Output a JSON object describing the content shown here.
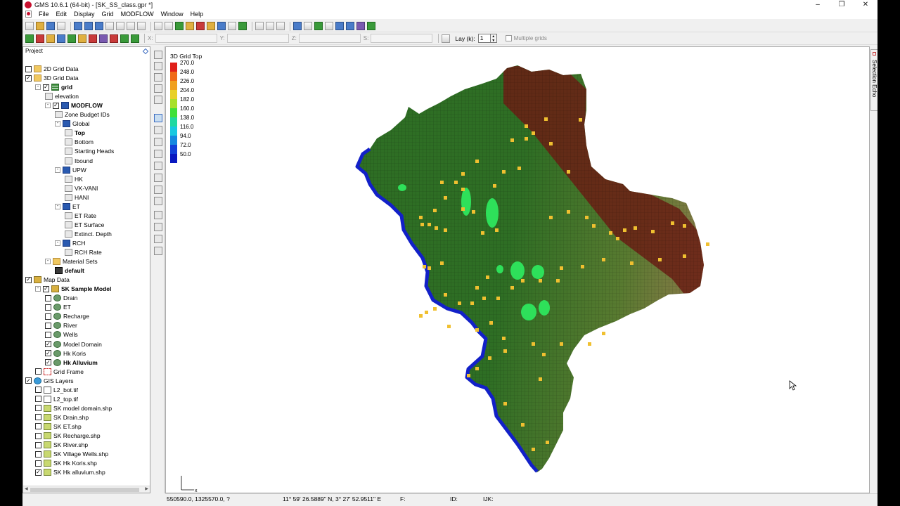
{
  "window": {
    "title": "GMS 10.6.1 (64-bit) - [SK_SS_class.gpr *]"
  },
  "menu": [
    "File",
    "Edit",
    "Display",
    "Grid",
    "MODFLOW",
    "Window",
    "Help"
  ],
  "toolbar2": {
    "x_label": "X:",
    "y_label": "Y:",
    "z_label": "Z:",
    "s_label": "S:",
    "layer_label": "Lay (k):",
    "layer_value": "1",
    "multiple_grids_label": "Multiple grids"
  },
  "project": {
    "header": "Project",
    "items": [
      {
        "label": "2D Grid Data",
        "indent": 0,
        "check": "none",
        "icon": "folder",
        "expander": "",
        "bold": false
      },
      {
        "label": "3D Grid Data",
        "indent": 0,
        "check": "checked",
        "icon": "folder",
        "expander": "",
        "bold": false
      },
      {
        "label": "grid",
        "indent": 1,
        "check": "checked",
        "icon": "grid",
        "expander": "-",
        "bold": true
      },
      {
        "label": "elevation",
        "indent": 2,
        "check": "",
        "icon": "ds",
        "expander": "",
        "bold": false
      },
      {
        "label": "MODFLOW",
        "indent": 2,
        "check": "checked",
        "icon": "mf",
        "expander": "-",
        "bold": true
      },
      {
        "label": "Zone Budget IDs",
        "indent": 3,
        "check": "",
        "icon": "ds",
        "expander": "",
        "bold": false
      },
      {
        "label": "Global",
        "indent": 3,
        "check": "",
        "icon": "mf",
        "expander": "-",
        "bold": false
      },
      {
        "label": "Top",
        "indent": 4,
        "check": "",
        "icon": "ds",
        "expander": "",
        "bold": true
      },
      {
        "label": "Bottom",
        "indent": 4,
        "check": "",
        "icon": "ds",
        "expander": "",
        "bold": false
      },
      {
        "label": "Starting Heads",
        "indent": 4,
        "check": "",
        "icon": "ds",
        "expander": "",
        "bold": false
      },
      {
        "label": "Ibound",
        "indent": 4,
        "check": "",
        "icon": "ds",
        "expander": "",
        "bold": false
      },
      {
        "label": "UPW",
        "indent": 3,
        "check": "",
        "icon": "mf",
        "expander": "-",
        "bold": false
      },
      {
        "label": "HK",
        "indent": 4,
        "check": "",
        "icon": "ds",
        "expander": "",
        "bold": false
      },
      {
        "label": "VK-VANI",
        "indent": 4,
        "check": "",
        "icon": "ds",
        "expander": "",
        "bold": false
      },
      {
        "label": "HANI",
        "indent": 4,
        "check": "",
        "icon": "ds",
        "expander": "",
        "bold": false
      },
      {
        "label": "ET",
        "indent": 3,
        "check": "",
        "icon": "mf",
        "expander": "-",
        "bold": false
      },
      {
        "label": "ET Rate",
        "indent": 4,
        "check": "",
        "icon": "ds",
        "expander": "",
        "bold": false
      },
      {
        "label": "ET Surface",
        "indent": 4,
        "check": "",
        "icon": "ds",
        "expander": "",
        "bold": false
      },
      {
        "label": "Extinct. Depth",
        "indent": 4,
        "check": "",
        "icon": "ds",
        "expander": "",
        "bold": false
      },
      {
        "label": "RCH",
        "indent": 3,
        "check": "",
        "icon": "mf",
        "expander": "-",
        "bold": false
      },
      {
        "label": "RCH Rate",
        "indent": 4,
        "check": "",
        "icon": "ds",
        "expander": "",
        "bold": false
      },
      {
        "label": "Material Sets",
        "indent": 2,
        "check": "",
        "icon": "folder",
        "expander": "-",
        "bold": false
      },
      {
        "label": "default",
        "indent": 3,
        "check": "",
        "icon": "mat",
        "expander": "",
        "bold": true
      },
      {
        "label": "Map Data",
        "indent": 0,
        "check": "checked",
        "icon": "map",
        "expander": "",
        "bold": false
      },
      {
        "label": "SK Sample Model",
        "indent": 1,
        "check": "checked",
        "icon": "map",
        "expander": "-",
        "bold": true
      },
      {
        "label": "Drain",
        "indent": 2,
        "check": "none",
        "icon": "cov",
        "expander": "",
        "bold": false
      },
      {
        "label": "ET",
        "indent": 2,
        "check": "none",
        "icon": "cov",
        "expander": "",
        "bold": false
      },
      {
        "label": "Recharge",
        "indent": 2,
        "check": "none",
        "icon": "cov",
        "expander": "",
        "bold": false
      },
      {
        "label": "River",
        "indent": 2,
        "check": "none",
        "icon": "cov",
        "expander": "",
        "bold": false
      },
      {
        "label": "Wells",
        "indent": 2,
        "check": "none",
        "icon": "cov",
        "expander": "",
        "bold": false
      },
      {
        "label": "Model Domain",
        "indent": 2,
        "check": "checked",
        "icon": "cov",
        "expander": "",
        "bold": false
      },
      {
        "label": "Hk Koris",
        "indent": 2,
        "check": "checked",
        "icon": "cov",
        "expander": "",
        "bold": false
      },
      {
        "label": "Hk Alluvium",
        "indent": 2,
        "check": "checked",
        "icon": "cov",
        "expander": "",
        "bold": true
      },
      {
        "label": "Grid Frame",
        "indent": 1,
        "check": "none",
        "icon": "frame",
        "expander": "",
        "bold": false
      },
      {
        "label": "GIS Layers",
        "indent": 0,
        "check": "checked",
        "icon": "gis",
        "expander": "",
        "bold": false
      },
      {
        "label": "L2_bot.tif",
        "indent": 1,
        "check": "none",
        "icon": "tif",
        "expander": "",
        "bold": false
      },
      {
        "label": "L2_top.tif",
        "indent": 1,
        "check": "none",
        "icon": "tif",
        "expander": "",
        "bold": false
      },
      {
        "label": "SK model domain.shp",
        "indent": 1,
        "check": "none",
        "icon": "shp",
        "expander": "",
        "bold": false
      },
      {
        "label": "SK Drain.shp",
        "indent": 1,
        "check": "none",
        "icon": "shp",
        "expander": "",
        "bold": false
      },
      {
        "label": "SK ET.shp",
        "indent": 1,
        "check": "none",
        "icon": "shp",
        "expander": "",
        "bold": false
      },
      {
        "label": "SK Recharge.shp",
        "indent": 1,
        "check": "none",
        "icon": "shp",
        "expander": "",
        "bold": false
      },
      {
        "label": "SK River.shp",
        "indent": 1,
        "check": "none",
        "icon": "shp",
        "expander": "",
        "bold": false
      },
      {
        "label": "SK Village Wells.shp",
        "indent": 1,
        "check": "none",
        "icon": "shp",
        "expander": "",
        "bold": false
      },
      {
        "label": "SK Hk Koris.shp",
        "indent": 1,
        "check": "none",
        "icon": "shp",
        "expander": "",
        "bold": false
      },
      {
        "label": "SK Hk alluvium.shp",
        "indent": 1,
        "check": "checked",
        "icon": "shp",
        "expander": "",
        "bold": false
      }
    ]
  },
  "legend": {
    "title": "3D Grid Top",
    "entries": [
      {
        "value": "270.0",
        "color": "#e0201a"
      },
      {
        "value": "248.0",
        "color": "#f06a18"
      },
      {
        "value": "226.0",
        "color": "#f0a020"
      },
      {
        "value": "204.0",
        "color": "#e8d028"
      },
      {
        "value": "182.0",
        "color": "#a8e02a"
      },
      {
        "value": "160.0",
        "color": "#40e03a"
      },
      {
        "value": "138.0",
        "color": "#20d8a0"
      },
      {
        "value": "116.0",
        "color": "#18c8e0"
      },
      {
        "value": "94.0",
        "color": "#1488e0"
      },
      {
        "value": "72.0",
        "color": "#1040d8"
      },
      {
        "value": "50.0",
        "color": "#0818c0"
      }
    ]
  },
  "map_colors": {
    "low": "#2e6e24",
    "mid": "#587a30",
    "high": "#8a7a48",
    "peak": "#6a1e14",
    "river": "#1220c8",
    "wells": "#f0c030",
    "alluvium": "#2ee05a"
  },
  "side_panel": {
    "label": "Selection Echo"
  },
  "status": {
    "coords": "550590.0, 1325570.0, ?",
    "geo": "11° 59' 26.5889\" N, 3° 27' 52.9511\" E",
    "f": "F:",
    "id": "ID:",
    "ijk": "IJK:"
  }
}
